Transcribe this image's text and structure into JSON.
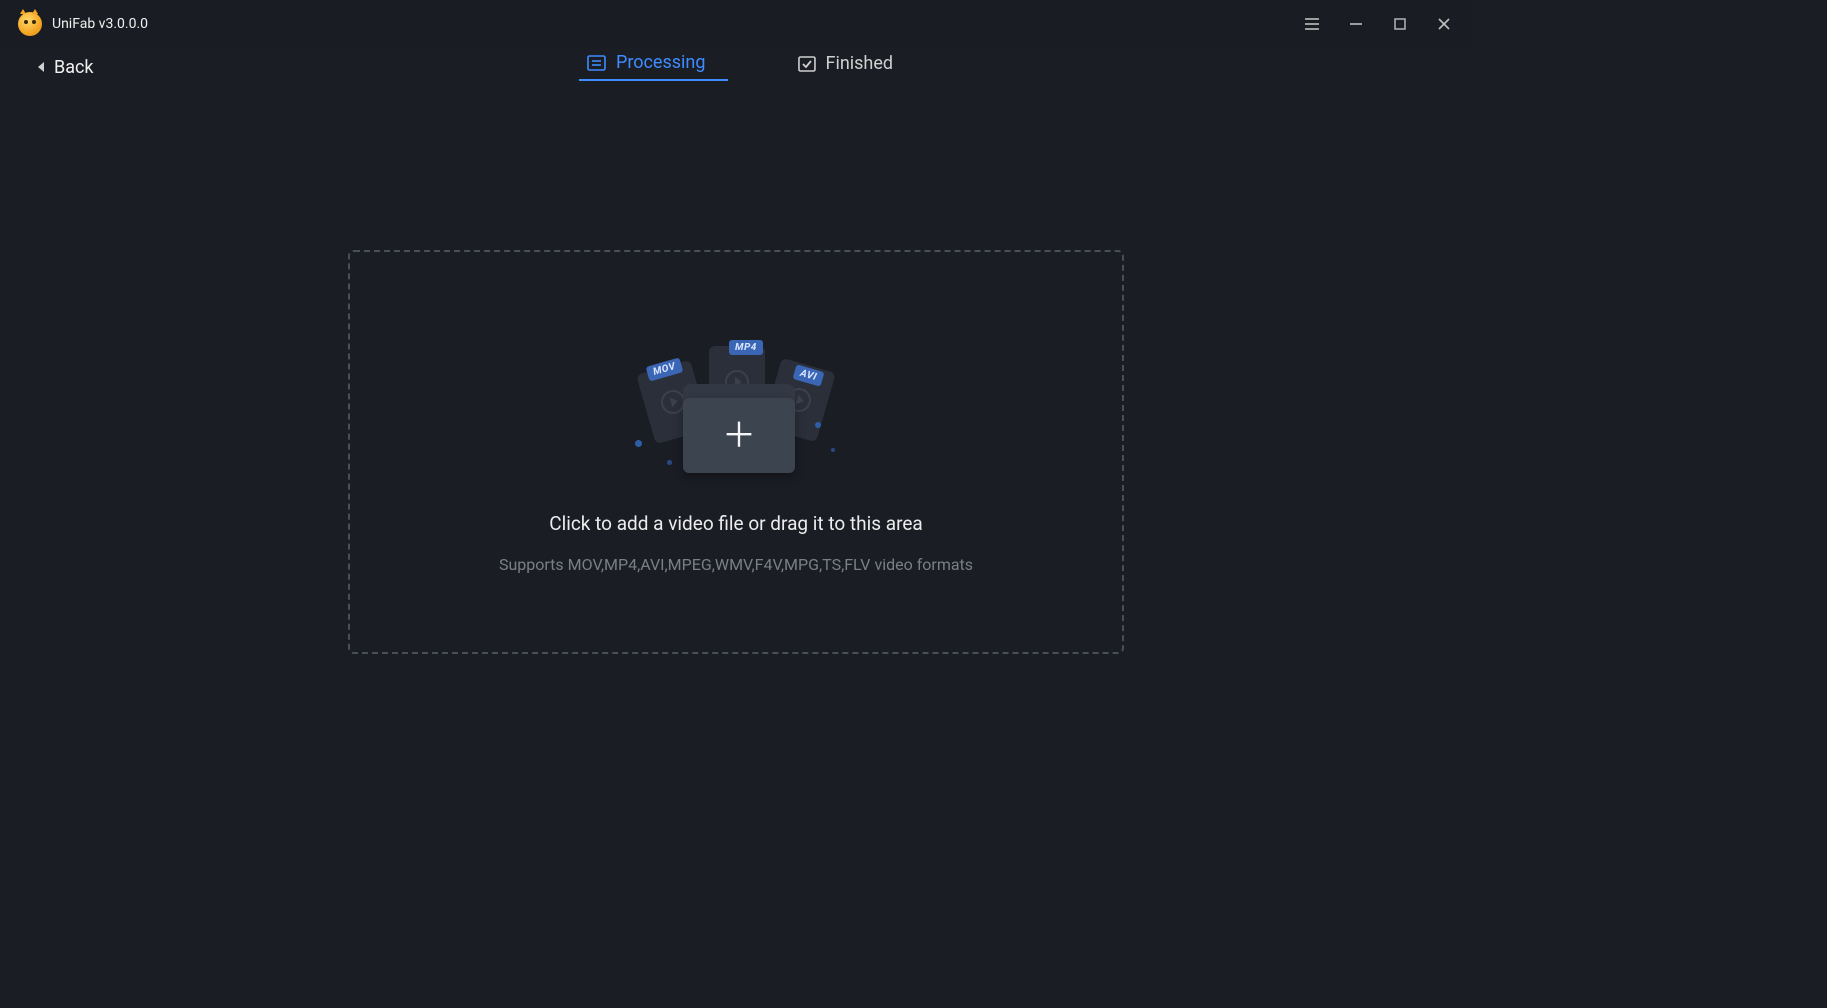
{
  "app": {
    "title": "UniFab v3.0.0.0"
  },
  "nav": {
    "back_label": "Back"
  },
  "tabs": {
    "processing": {
      "label": "Processing"
    },
    "finished": {
      "label": "Finished"
    }
  },
  "dropzone": {
    "title": "Click to add a video file or drag it to this area",
    "subtitle": "Supports MOV,MP4,AVI,MPEG,WMV,F4V,MPG,TS,FLV video formats",
    "tags": {
      "mov": "MOV",
      "mp4": "MP4",
      "avi": "AVI"
    }
  }
}
